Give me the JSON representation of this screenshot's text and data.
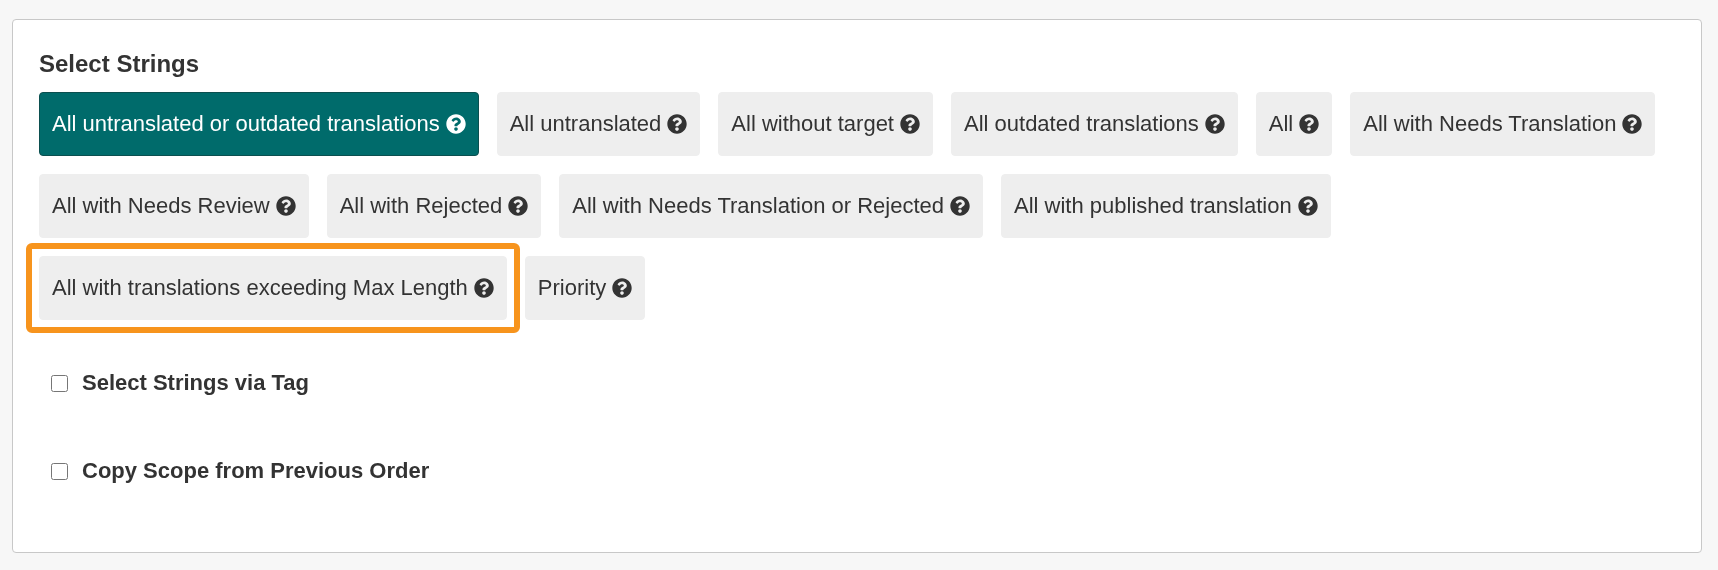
{
  "section": {
    "title": "Select Strings"
  },
  "filters": [
    {
      "label": "All untranslated or outdated translations",
      "selected": true,
      "highlighted": false
    },
    {
      "label": "All untranslated",
      "selected": false,
      "highlighted": false
    },
    {
      "label": "All without target",
      "selected": false,
      "highlighted": false
    },
    {
      "label": "All outdated translations",
      "selected": false,
      "highlighted": false
    },
    {
      "label": "All",
      "selected": false,
      "highlighted": false
    },
    {
      "label": "All with Needs Translation",
      "selected": false,
      "highlighted": false
    },
    {
      "label": "All with Needs Review",
      "selected": false,
      "highlighted": false
    },
    {
      "label": "All with Rejected",
      "selected": false,
      "highlighted": false
    },
    {
      "label": "All with Needs Translation or Rejected",
      "selected": false,
      "highlighted": false
    },
    {
      "label": "All with published translation",
      "selected": false,
      "highlighted": false
    },
    {
      "label": "All with translations exceeding Max Length",
      "selected": false,
      "highlighted": true
    },
    {
      "label": "Priority",
      "selected": false,
      "highlighted": false
    }
  ],
  "options": [
    {
      "label": "Select Strings via Tag",
      "checked": false
    },
    {
      "label": "Copy Scope from Previous Order",
      "checked": false
    }
  ]
}
